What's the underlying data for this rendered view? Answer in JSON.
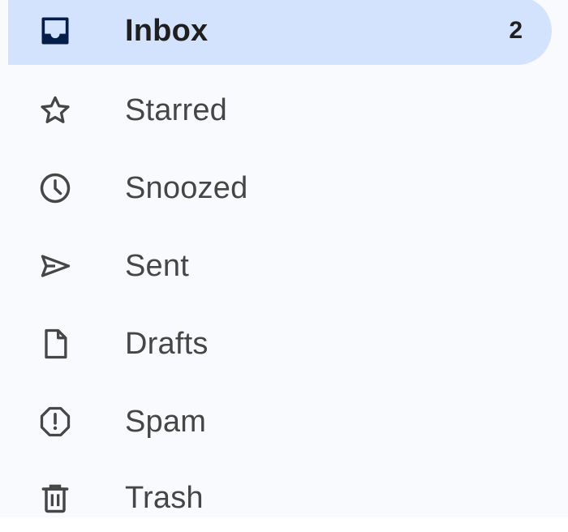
{
  "colors": {
    "active_bg": "#d3e3fd",
    "page_bg": "#f8fafd",
    "text": "#444746",
    "active_text": "#1f1f1f"
  },
  "nav": {
    "items": [
      {
        "label": "Inbox",
        "icon": "inbox-icon",
        "count": "2",
        "active": true
      },
      {
        "label": "Starred",
        "icon": "star-icon",
        "active": false
      },
      {
        "label": "Snoozed",
        "icon": "clock-icon",
        "active": false
      },
      {
        "label": "Sent",
        "icon": "send-icon",
        "active": false
      },
      {
        "label": "Drafts",
        "icon": "draft-file-icon",
        "active": false
      },
      {
        "label": "Spam",
        "icon": "spam-alert-icon",
        "active": false
      },
      {
        "label": "Trash",
        "icon": "trash-icon",
        "active": false
      }
    ]
  }
}
